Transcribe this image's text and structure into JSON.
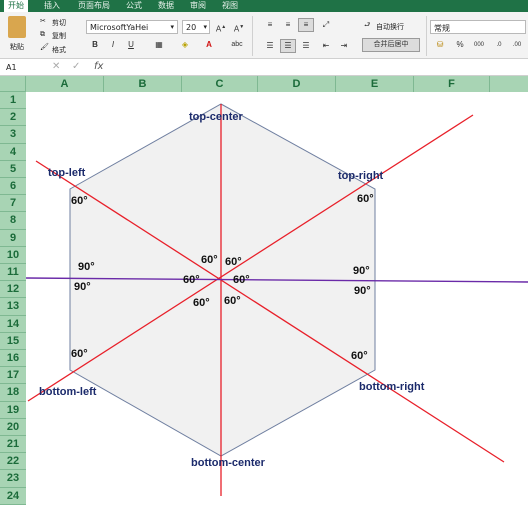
{
  "menu": [
    "开始",
    "插入",
    "页面布局",
    "公式",
    "数据",
    "审阅",
    "视图"
  ],
  "ribbon": {
    "paste": "粘贴",
    "cut": "剪切",
    "copy": "复制",
    "format": "格式",
    "font_name": "MicrosoftYaHei",
    "font_size": "20",
    "wrap": "自动换行",
    "merge": "合并后居中",
    "number_format": "常规"
  },
  "formula_bar": {
    "cell_ref": "A1",
    "fx": "fx",
    "value": ""
  },
  "columns": [
    "A",
    "B",
    "C",
    "D",
    "E",
    "F"
  ],
  "rows": [
    "1",
    "2",
    "3",
    "4",
    "5",
    "6",
    "7",
    "8",
    "9",
    "10",
    "11",
    "12",
    "13",
    "14",
    "15",
    "16",
    "17",
    "18",
    "19",
    "20",
    "21",
    "22",
    "23",
    "24"
  ],
  "diagram": {
    "vertex_labels": [
      "top-center",
      "top-left",
      "top-right",
      "bottom-left",
      "bottom-right",
      "bottom-center"
    ],
    "angle_label_60": "60°",
    "angle_label_90": "90°",
    "colors": {
      "hexagon_fill": "#f1f1f1",
      "hexagon_stroke": "#6f7fa0",
      "red_lines": "#e8202a",
      "horizontal_line": "#6a2aa8"
    }
  }
}
